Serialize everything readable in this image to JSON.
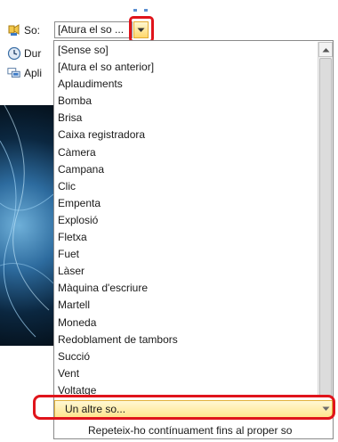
{
  "ribbon": {
    "sound_label": "So:",
    "duration_label": "Dur",
    "apply_label": "Apli"
  },
  "sound_combo": {
    "value": "[Atura el so ..."
  },
  "dropdown": {
    "options": [
      "[Sense so]",
      "[Atura el so anterior]",
      "Aplaudiments",
      "Bomba",
      "Brisa",
      "Caixa registradora",
      "Càmera",
      "Campana",
      "Clic",
      "Empenta",
      "Explosió",
      "Fletxa",
      "Fuet",
      "Làser",
      "Màquina d'escriure",
      "Martell",
      "Moneda",
      "Redoblament de tambors",
      "Succió",
      "Vent",
      "Voltatge"
    ],
    "other_sound": "Un altre so...",
    "loop_until_next": "Repeteix-ho contínuament fins al proper so"
  },
  "colors": {
    "highlight": "#e0141b",
    "hover": "#ffe58e",
    "accent_selected": "#3399ff"
  },
  "icons": {
    "sound": "sound-icon",
    "duration": "clock-icon",
    "apply": "apply-to-all-icon",
    "dropdown_arrow": "chevron-down-icon",
    "scroll_up": "scroll-up-arrow-icon"
  }
}
